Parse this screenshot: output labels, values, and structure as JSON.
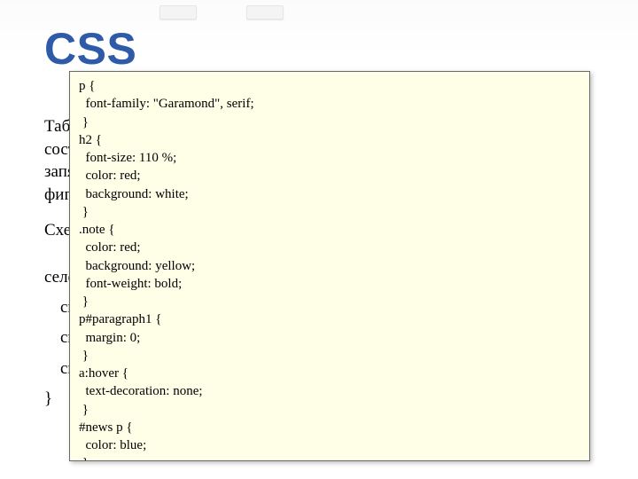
{
  "title": "CSS",
  "paragraph1": "Таблица стилей - это набор правил, которые, в свою очередь, состоят из одного или нескольких селекторов, разделённых запятыми, и блока определений. Блок определений обрамляется фигурными скобками, и состоит из набора свойств и их значений.",
  "paragraph2": "Схематически это можно показать так:",
  "schema_selector": "селектор, селектор {",
  "schema_prop1": "свойство: значение;",
  "schema_prop2": "свойство: значение;",
  "schema_prop3": "свойство: значение;",
  "schema_close": "}",
  "code": "p {\n  font-family: \"Garamond\", serif;\n }\nh2 {\n  font-size: 110 %;\n  color: red;\n  background: white;\n }\n.note {\n  color: red;\n  background: yellow;\n  font-weight: bold;\n }\np#paragraph1 {\n  margin: 0;\n }\na:hover {\n  text-decoration: none;\n }\n#news p {\n  color: blue;\n }"
}
